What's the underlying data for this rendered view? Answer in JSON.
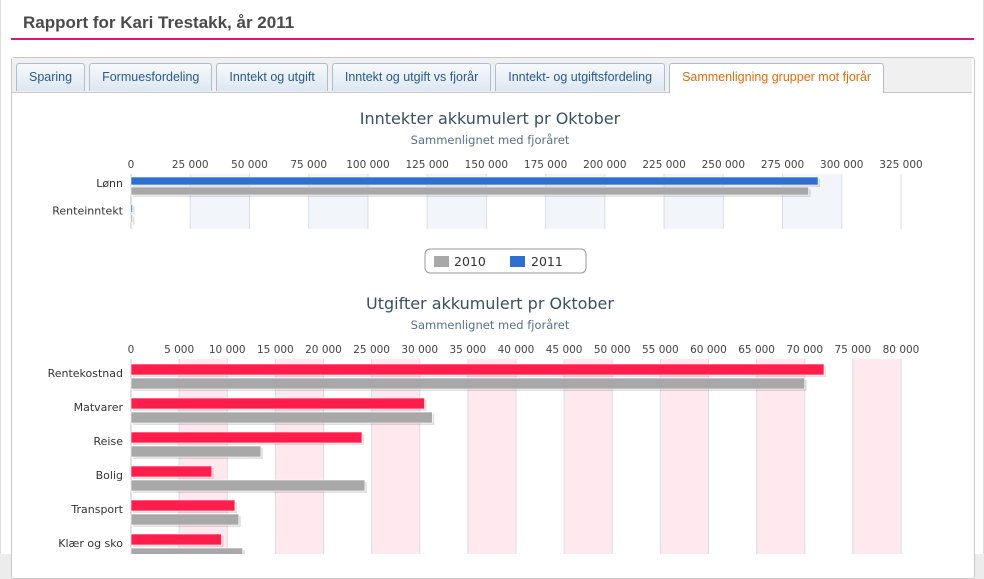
{
  "header": {
    "title": "Rapport for Kari Trestakk, år 2011"
  },
  "tabs": [
    {
      "label": "Sparing"
    },
    {
      "label": "Formuesfordeling"
    },
    {
      "label": "Inntekt og utgift"
    },
    {
      "label": "Inntekt og utgift vs fjorår"
    },
    {
      "label": "Inntekt- og utgiftsfordeling"
    },
    {
      "label": "Sammenligning grupper mot fjorår",
      "active": true
    }
  ],
  "legend": {
    "items": [
      {
        "label": "2010",
        "color": "#a8a8a8"
      },
      {
        "label": "2011",
        "color": "#2f6fcf"
      }
    ]
  },
  "chart_data": [
    {
      "type": "bar",
      "orientation": "horizontal",
      "title": "Inntekter akkumulert pr Oktober",
      "subtitle": "Sammenlignet med fjoråret",
      "categories": [
        "Lønn",
        "Renteinntekt"
      ],
      "series": [
        {
          "name": "2011",
          "color": "#2f6fcf",
          "values": [
            290000,
            600
          ]
        },
        {
          "name": "2010",
          "color": "#a8a8a8",
          "values": [
            286000,
            300
          ]
        }
      ],
      "xlim": [
        0,
        325000
      ],
      "ticks": [
        0,
        25000,
        50000,
        75000,
        100000,
        125000,
        150000,
        175000,
        200000,
        225000,
        250000,
        275000,
        300000,
        325000
      ],
      "tick_labels": [
        "0",
        "25 000",
        "50 000",
        "75 000",
        "100 000",
        "125 000",
        "150 000",
        "175 000",
        "200 000",
        "225 000",
        "250 000",
        "275 000",
        "300 000",
        "325 000"
      ],
      "band_color": "#f2f5fa"
    },
    {
      "type": "bar",
      "orientation": "horizontal",
      "title": "Utgifter akkumulert pr Oktober",
      "subtitle": "Sammenlignet med fjoråret",
      "categories": [
        "Rentekostnad",
        "Matvarer",
        "Reise",
        "Bolig",
        "Transport",
        "Klær og sko"
      ],
      "series": [
        {
          "name": "2011",
          "color": "#ff1d4c",
          "values": [
            72000,
            30500,
            24000,
            8400,
            10800,
            9400
          ]
        },
        {
          "name": "2010",
          "color": "#a8a8a8",
          "values": [
            70000,
            31300,
            13500,
            24300,
            11200,
            11600
          ]
        }
      ],
      "xlim": [
        0,
        80000
      ],
      "ticks": [
        0,
        5000,
        10000,
        15000,
        20000,
        25000,
        30000,
        35000,
        40000,
        45000,
        50000,
        55000,
        60000,
        65000,
        70000,
        75000,
        80000
      ],
      "tick_labels": [
        "0",
        "5 000",
        "10 000",
        "15 000",
        "20 000",
        "25 000",
        "30 000",
        "35 000",
        "40 000",
        "45 000",
        "50 000",
        "55 000",
        "60 000",
        "65 000",
        "70 000",
        "75 000",
        "80 000"
      ],
      "band_color": "#ffe8ee"
    }
  ]
}
